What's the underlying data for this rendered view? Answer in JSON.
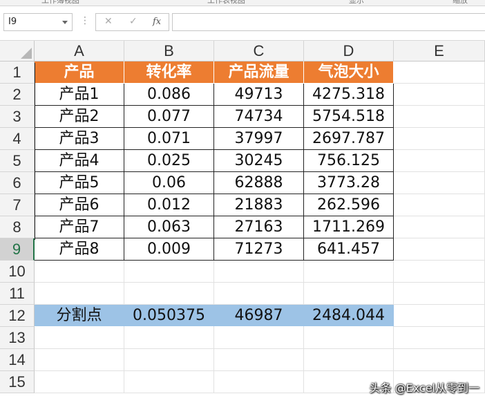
{
  "ribbon": {
    "labels": [
      "工作簿视图",
      "工作表视图",
      "显示",
      "缩放"
    ]
  },
  "formula_bar": {
    "name_box": "I9",
    "dots": "⋮",
    "cancel_icon": "✕",
    "confirm_icon": "✓",
    "fx_label": "fx",
    "formula_value": ""
  },
  "columns": [
    "A",
    "B",
    "C",
    "D",
    "E"
  ],
  "rows": [
    "1",
    "2",
    "3",
    "4",
    "5",
    "6",
    "7",
    "8",
    "9",
    "10",
    "11",
    "12",
    "13",
    "14",
    "15"
  ],
  "table": {
    "headers": [
      "产品",
      "转化率",
      "产品流量",
      "气泡大小"
    ],
    "data": [
      [
        "产品1",
        "0.086",
        "49713",
        "4275.318"
      ],
      [
        "产品2",
        "0.077",
        "74734",
        "5754.518"
      ],
      [
        "产品3",
        "0.071",
        "37997",
        "2697.787"
      ],
      [
        "产品4",
        "0.025",
        "30245",
        "756.125"
      ],
      [
        "产品5",
        "0.06",
        "62888",
        "3773.28"
      ],
      [
        "产品6",
        "0.012",
        "21883",
        "262.596"
      ],
      [
        "产品7",
        "0.063",
        "27163",
        "1711.269"
      ],
      [
        "产品8",
        "0.009",
        "71273",
        "641.457"
      ]
    ]
  },
  "split_row": [
    "分割点",
    "0.050375",
    "46987",
    "2484.044"
  ],
  "colors": {
    "header_fill": "#ed7d31",
    "split_fill": "#9dc3e6",
    "excel_green": "#217346"
  },
  "watermark": "头条 @Excel从零到一"
}
